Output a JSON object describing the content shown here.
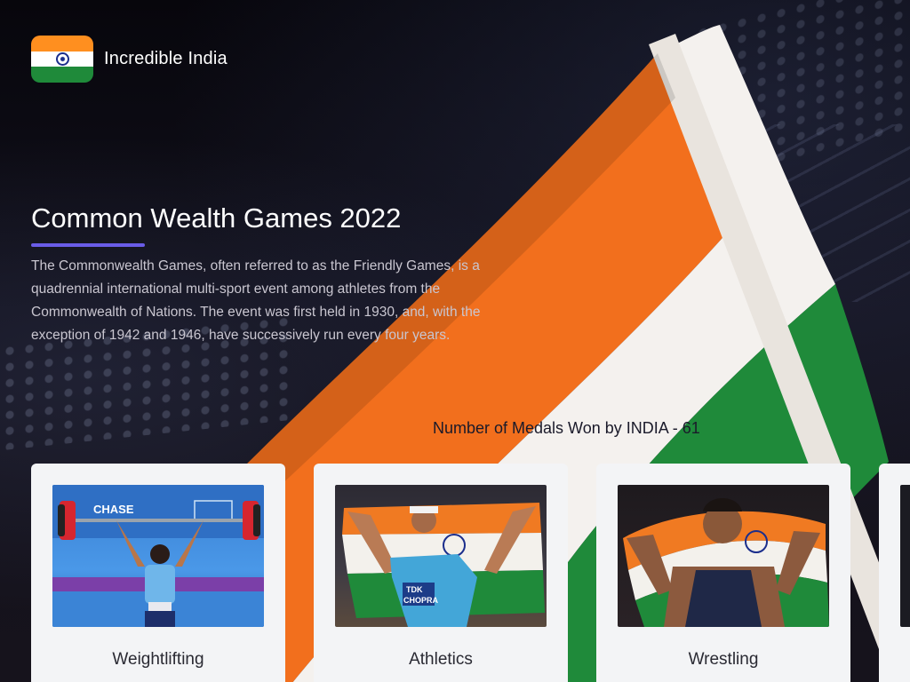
{
  "brand": {
    "name": "Incredible India",
    "logo_icon": "india-flag-icon"
  },
  "hero": {
    "title": "Common Wealth Games 2022",
    "description": "The Commonwealth Games, often referred to as the Friendly Games, is a quadrennial international multi-sport event among athletes from the Commonwealth of Nations. The event was first held in 1930, and, with the exception of 1942 and 1946, have successively run every four years."
  },
  "medals": {
    "label": "Number of Medals Won by INDIA - 61"
  },
  "cards": [
    {
      "title": "Weightlifting",
      "photo_label": "weightlifting-photo",
      "caption_banner": "CHASE"
    },
    {
      "title": "Athletics",
      "photo_label": "athletics-photo",
      "bib_brand": "TDK",
      "bib_name": "CHOPRA"
    },
    {
      "title": "Wrestling",
      "photo_label": "wrestling-photo"
    }
  ],
  "colors": {
    "saffron": "#ff8f1f",
    "white": "#ffffff",
    "green": "#1f8a3a",
    "accent": "#6a5ce8",
    "card_bg": "#f3f4f6",
    "page_bg": "#0b0a12"
  }
}
